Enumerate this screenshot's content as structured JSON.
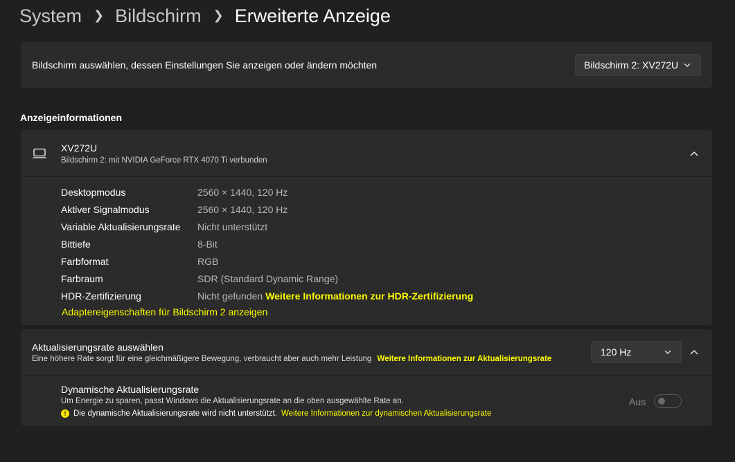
{
  "breadcrumb": {
    "items": [
      "System",
      "Bildschirm"
    ],
    "current": "Erweiterte Anzeige"
  },
  "monitor_select": {
    "label": "Bildschirm auswählen, dessen Einstellungen Sie anzeigen oder ändern möchten",
    "selected": "Bildschirm 2: XV272U"
  },
  "display_info": {
    "section_title": "Anzeigeinformationen",
    "monitor_name": "XV272U",
    "monitor_subtitle": "Bildschirm 2: mit NVIDIA GeForce RTX 4070 Ti verbunden",
    "rows": [
      {
        "key": "Desktopmodus",
        "value": "2560 × 1440, 120 Hz"
      },
      {
        "key": "Aktiver Signalmodus",
        "value": "2560 × 1440, 120 Hz"
      },
      {
        "key": "Variable Aktualisierungsrate",
        "value": "Nicht unterstützt"
      },
      {
        "key": "Bittiefe",
        "value": "8-Bit"
      },
      {
        "key": "Farbformat",
        "value": "RGB"
      },
      {
        "key": "Farbraum",
        "value": "SDR (Standard Dynamic Range)"
      },
      {
        "key": "HDR-Zertifizierung",
        "value": "Nicht gefunden",
        "link": "Weitere Informationen zur HDR-Zertifizierung"
      }
    ],
    "adapter_link": "Adaptereigenschaften für Bildschirm 2 anzeigen"
  },
  "refresh_rate": {
    "title": "Aktualisierungsrate auswählen",
    "subtitle": "Eine höhere Rate sorgt für eine gleichmäßigere Bewegung, verbraucht aber auch mehr Leistung",
    "link": "Weitere Informationen zur Aktualisierungsrate",
    "selected": "120 Hz"
  },
  "dynamic_rate": {
    "title": "Dynamische Aktualisierungsrate",
    "subtitle": "Um Energie zu sparen, passt Windows die Aktualisierungsrate an die oben ausgewählte Rate an.",
    "warning_icon": "!",
    "warning": "Die dynamische Aktualisierungsrate wird nicht unterstützt.",
    "link": "Weitere Informationen zur dynamischen Aktualisierungsrate",
    "toggle_label": "Aus"
  },
  "colors": {
    "background": "#202020",
    "card": "#2b2b2b",
    "link": "#ffff00"
  },
  "icons": [
    "chevron-right-icon",
    "chevron-down-icon",
    "chevron-up-icon",
    "monitor-icon",
    "warning-icon"
  ]
}
